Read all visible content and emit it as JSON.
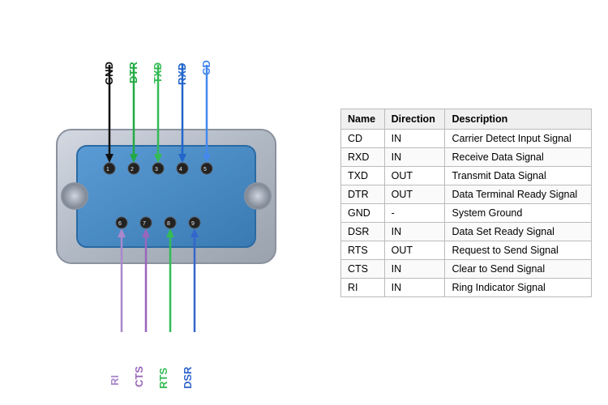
{
  "diagram": {
    "labels": {
      "GND": {
        "text": "GND",
        "color": "#111111"
      },
      "DTR": {
        "text": "DTR",
        "color": "#22aa44"
      },
      "TXD": {
        "text": "TXD",
        "color": "#33bb55"
      },
      "RXD": {
        "text": "RXD",
        "color": "#2266cc"
      },
      "CD": {
        "text": "CD",
        "color": "#4488ee"
      },
      "RI": {
        "text": "RI",
        "color": "#aa88cc"
      },
      "CTS": {
        "text": "CTS",
        "color": "#9966bb"
      },
      "RTS": {
        "text": "RTS",
        "color": "#33bb55"
      },
      "DSR": {
        "text": "DSR",
        "color": "#3366cc"
      }
    }
  },
  "table": {
    "headers": [
      "Name",
      "Direction",
      "Description"
    ],
    "rows": [
      [
        "CD",
        "IN",
        "Carrier Detect Input Signal"
      ],
      [
        "RXD",
        "IN",
        "Receive Data Signal"
      ],
      [
        "TXD",
        "OUT",
        "Transmit Data Signal"
      ],
      [
        "DTR",
        "OUT",
        "Data Terminal Ready Signal"
      ],
      [
        "GND",
        "-",
        "System Ground"
      ],
      [
        "DSR",
        "IN",
        "Data Set Ready Signal"
      ],
      [
        "RTS",
        "OUT",
        "Request to Send Signal"
      ],
      [
        "CTS",
        "IN",
        "Clear to Send Signal"
      ],
      [
        "RI",
        "IN",
        "Ring Indicator Signal"
      ]
    ]
  }
}
